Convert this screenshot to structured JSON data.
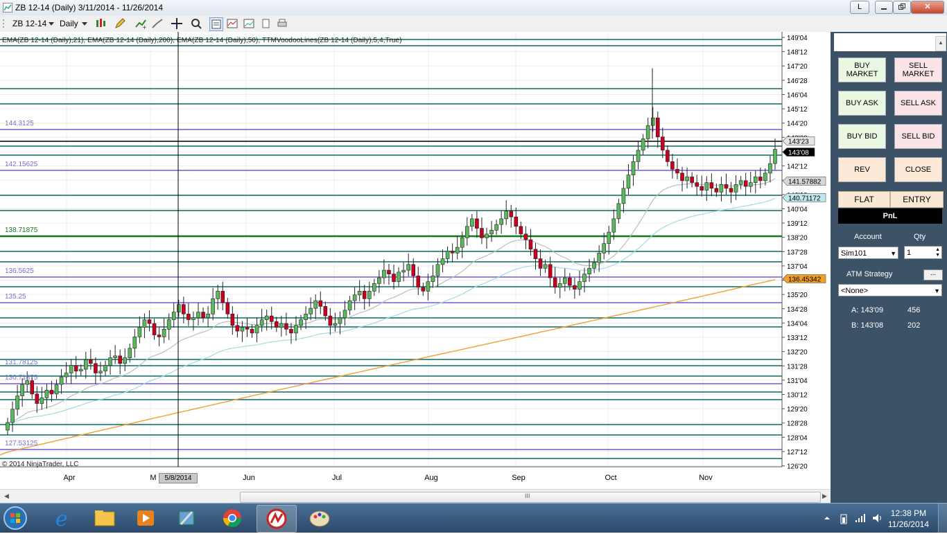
{
  "window": {
    "title": "ZB 12-14 (Daily)  3/11/2014 - 11/26/2014",
    "controls": [
      "L",
      "minimize",
      "restore",
      "close"
    ],
    "control_labels": {
      "l": "L",
      "close": "✕"
    }
  },
  "toolbar": {
    "instrument": "ZB 12-14",
    "interval": "Daily",
    "icons": [
      "bar-style-icon",
      "drawing-pencil-icon",
      "add-indicator-icon",
      "strategy-icon",
      "crosshair-icon",
      "zoom-icon",
      "data-box-icon",
      "chart-properties-icon",
      "copy-icon",
      "print-icon"
    ]
  },
  "chart": {
    "indicator_label": "EMA(ZB 12-14 (Daily),21), EMA(ZB 12-14 (Daily),200), EMA(ZB 12-14 (Daily),50), TTMVoodooLines(ZB 12-14 (Daily),5,4,True)",
    "copyright": "© 2014 NinjaTrader, LLC",
    "crosshair_date": "5/8/2014",
    "y_ticks": [
      "149'04",
      "148'12",
      "147'20",
      "146'28",
      "146'04",
      "145'12",
      "144'20",
      "143'28",
      "143'04",
      "142'12",
      "141'20",
      "140'28",
      "140'04",
      "139'12",
      "138'20",
      "137'28",
      "137'04",
      "136'12",
      "135'20",
      "134'28",
      "134'04",
      "133'12",
      "132'20",
      "131'28",
      "131'04",
      "130'12",
      "129'20",
      "128'28",
      "128'04",
      "127'12",
      "126'20"
    ],
    "x_labels": [
      "Apr",
      "M",
      "Jun",
      "Jul",
      "Aug",
      "Sep",
      "Oct",
      "Nov"
    ],
    "level_labels": [
      "144.3125",
      "142.15625",
      "138.71875",
      "136.5625",
      "135.25",
      "131.78125",
      "130.71875",
      "127.53125"
    ],
    "price_markers": {
      "ask_box": "143'23",
      "last": "143'08",
      "ema21": "141.57882",
      "ema50": "140.71172",
      "ema200": "136.45342"
    },
    "colors": {
      "up": "#5cb85c",
      "down": "#c8001e",
      "teal_line": "#2e7f7a",
      "purple_line": "#8a6fdc",
      "green_line": "#127a22",
      "ema200": "#f0a02a",
      "ema50": "#9fdce0",
      "ema21": "#bdbdbd"
    }
  },
  "panel": {
    "buttons": {
      "buy_market": "BUY MARKET",
      "sell_market": "SELL MARKET",
      "buy_ask": "BUY ASK",
      "sell_ask": "SELL ASK",
      "buy_bid": "BUY BID",
      "sell_bid": "SELL BID",
      "rev": "REV",
      "close": "CLOSE"
    },
    "tabs": {
      "flat": "FLAT",
      "entry": "ENTRY"
    },
    "pnl": "PnL",
    "account_label": "Account",
    "qty_label": "Qty",
    "account_value": "Sim101",
    "qty_value": "1",
    "atm_label": "ATM Strategy",
    "atm_more": "...",
    "atm_value": "<None>",
    "ask_label": "A: 143'09",
    "ask_size": "456",
    "bid_label": "B: 143'08",
    "bid_size": "202"
  },
  "taskbar": {
    "time": "12:38 PM",
    "date": "11/26/2014",
    "apps": [
      "start-orb-icon",
      "internet-explorer-icon",
      "file-explorer-icon",
      "media-player-icon",
      "control-panel-icon",
      "chrome-icon",
      "ninjatrader-icon",
      "paint-icon"
    ]
  }
}
